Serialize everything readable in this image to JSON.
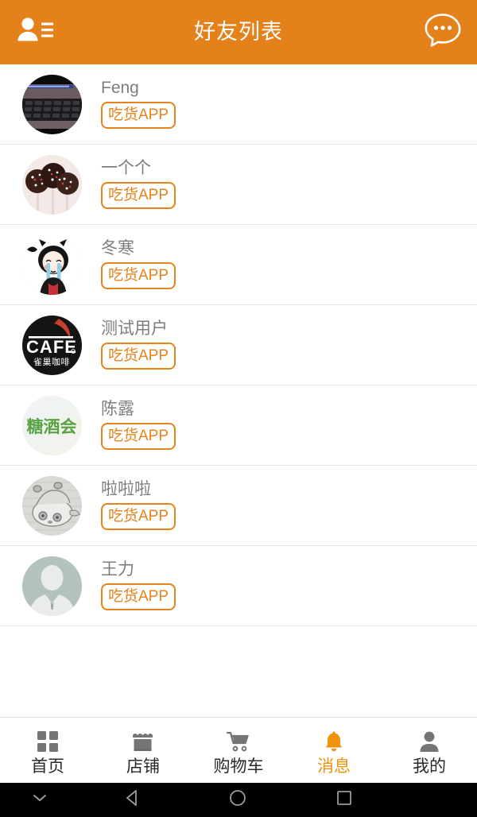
{
  "theme": {
    "header_bg": "#e5811a",
    "accent": "#e8821a",
    "tab_active": "#f0920a",
    "name_color": "#7d7d7d",
    "divider": "#e7e7e7"
  },
  "header": {
    "title": "好友列表",
    "left_icon": "contact-list-icon",
    "right_icon": "chat-bubble-icon"
  },
  "friends": [
    {
      "name": "Feng",
      "badge": "吃货APP",
      "avatar": "laptop-keyboard-photo"
    },
    {
      "name": "一个个",
      "badge": "吃货APP",
      "avatar": "chocolate-cake-pops-photo"
    },
    {
      "name": "冬寒",
      "badge": "吃货APP",
      "avatar": "crying-anime-girl-cartoon"
    },
    {
      "name": "测试用户",
      "badge": "吃货APP",
      "avatar": "cafe-nescafe-logo"
    },
    {
      "name": "陈露",
      "badge": "吃货APP",
      "avatar": "tangjiuhui-green-text-logo"
    },
    {
      "name": "啦啦啦",
      "badge": "吃货APP",
      "avatar": "panda-pencil-sketch"
    },
    {
      "name": "王力",
      "badge": "吃货APP",
      "avatar": "default-person-placeholder"
    }
  ],
  "tabs": [
    {
      "label": "首页",
      "icon": "grid-icon",
      "active": false
    },
    {
      "label": "店铺",
      "icon": "store-icon",
      "active": false
    },
    {
      "label": "购物车",
      "icon": "cart-icon",
      "active": false
    },
    {
      "label": "消息",
      "icon": "bell-icon",
      "active": true
    },
    {
      "label": "我的",
      "icon": "person-icon",
      "active": false
    }
  ],
  "navbar": {
    "hide_keyboard": "chevron-down-icon",
    "back": "back-triangle-icon",
    "home": "home-circle-icon",
    "recents": "recents-square-icon"
  }
}
